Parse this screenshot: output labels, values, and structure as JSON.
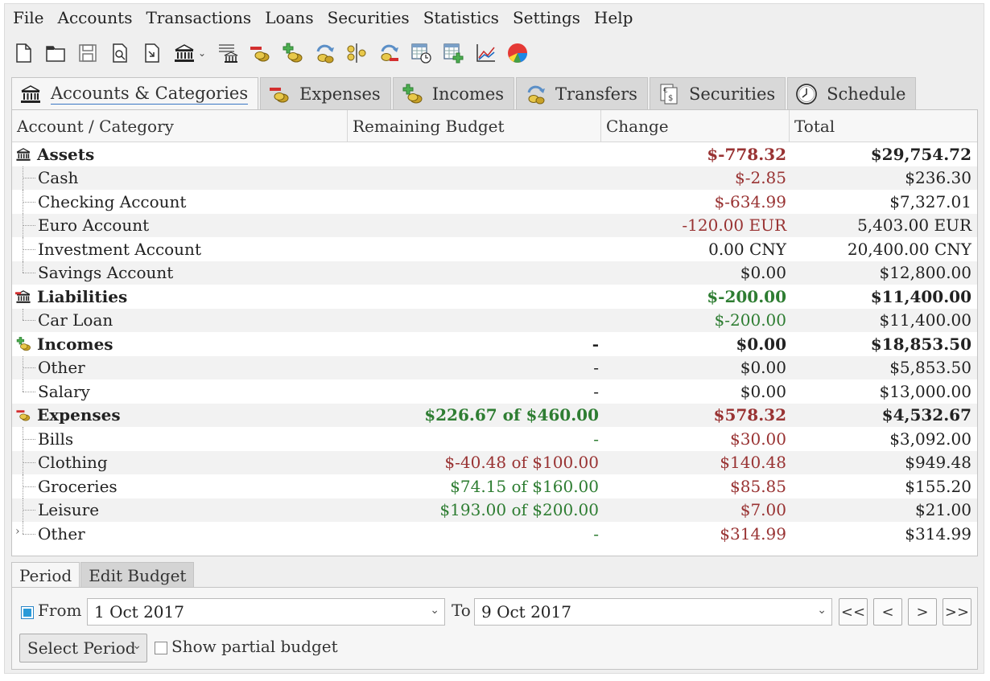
{
  "menu": [
    "File",
    "Accounts",
    "Transactions",
    "Loans",
    "Securities",
    "Statistics",
    "Settings",
    "Help"
  ],
  "toolbar": {
    "icons": [
      "new-file-icon",
      "open-folder-icon",
      "save-icon",
      "print-preview-icon",
      "export-icon",
      "bank-account-icon",
      "dropdown-arrow",
      "new-account-icon",
      "new-expense-icon",
      "new-income-icon",
      "new-transfer-icon",
      "split-transaction-icon",
      "repeat-transfer-icon",
      "schedule-icon",
      "add-schedule-icon",
      "line-chart-icon",
      "pie-chart-icon"
    ]
  },
  "tabs": [
    {
      "label": "Accounts & Categories",
      "icon": "bank-icon",
      "active": true
    },
    {
      "label": "Expenses",
      "icon": "expense-icon",
      "active": false
    },
    {
      "label": "Incomes",
      "icon": "income-icon",
      "active": false
    },
    {
      "label": "Transfers",
      "icon": "transfer-icon",
      "active": false
    },
    {
      "label": "Securities",
      "icon": "securities-icon",
      "active": false
    },
    {
      "label": "Schedule",
      "icon": "clock-icon",
      "active": false
    }
  ],
  "columns": [
    "Account / Category",
    "Remaining Budget",
    "Change",
    "Total"
  ],
  "rows": [
    {
      "name": "Assets",
      "level": 0,
      "icon": "bank",
      "budget": "",
      "change": "$-778.32",
      "change_color": "red",
      "total": "$29,754.72"
    },
    {
      "name": "Cash",
      "level": 1,
      "budget": "",
      "change": "$-2.85",
      "change_color": "red",
      "total": "$236.30"
    },
    {
      "name": "Checking Account",
      "level": 1,
      "budget": "",
      "change": "$-634.99",
      "change_color": "red",
      "total": "$7,327.01"
    },
    {
      "name": "Euro Account",
      "level": 1,
      "budget": "",
      "change": "-120.00 EUR",
      "change_color": "red",
      "total": "5,403.00 EUR"
    },
    {
      "name": "Investment Account",
      "level": 1,
      "budget": "",
      "change": "0.00 CNY",
      "change_color": "black",
      "total": "20,400.00 CNY"
    },
    {
      "name": "Savings Account",
      "level": 1,
      "budget": "",
      "change": "$0.00",
      "change_color": "black",
      "total": "$12,800.00",
      "last": true
    },
    {
      "name": "Liabilities",
      "level": 0,
      "icon": "bank-red",
      "budget": "",
      "change": "$-200.00",
      "change_color": "green",
      "total": "$11,400.00"
    },
    {
      "name": "Car Loan",
      "level": 1,
      "budget": "",
      "change": "$-200.00",
      "change_color": "green",
      "total": "$11,400.00",
      "last": true
    },
    {
      "name": "Incomes",
      "level": 0,
      "icon": "income",
      "budget": "-",
      "budget_color": "black",
      "change": "$0.00",
      "change_color": "black",
      "total": "$18,853.50"
    },
    {
      "name": "Other",
      "level": 1,
      "budget": "-",
      "budget_color": "black",
      "change": "$0.00",
      "change_color": "black",
      "total": "$5,853.50"
    },
    {
      "name": "Salary",
      "level": 1,
      "budget": "-",
      "budget_color": "black",
      "change": "$0.00",
      "change_color": "black",
      "total": "$13,000.00",
      "last": true
    },
    {
      "name": "Expenses",
      "level": 0,
      "icon": "expense",
      "budget": "$226.67 of $460.00",
      "budget_color": "green",
      "change": "$578.32",
      "change_color": "red",
      "total": "$4,532.67"
    },
    {
      "name": "Bills",
      "level": 1,
      "budget": "-",
      "budget_color": "green",
      "change": "$30.00",
      "change_color": "red",
      "total": "$3,092.00"
    },
    {
      "name": "Clothing",
      "level": 1,
      "budget": "$-40.48 of $100.00",
      "budget_color": "red",
      "change": "$140.48",
      "change_color": "red",
      "total": "$949.48"
    },
    {
      "name": "Groceries",
      "level": 1,
      "budget": "$74.15 of $160.00",
      "budget_color": "green",
      "change": "$85.85",
      "change_color": "red",
      "total": "$155.20"
    },
    {
      "name": "Leisure",
      "level": 1,
      "budget": "$193.00 of $200.00",
      "budget_color": "green",
      "change": "$7.00",
      "change_color": "red",
      "total": "$21.00"
    },
    {
      "name": "Other",
      "level": 1,
      "budget": "-",
      "budget_color": "green",
      "change": "$314.99",
      "change_color": "red",
      "total": "$314.99",
      "last": true,
      "expandable": true
    }
  ],
  "bottom_tabs": [
    "Period",
    "Edit Budget"
  ],
  "period": {
    "from_label": "From",
    "from_checked": true,
    "from_value": "1 Oct 2017",
    "to_label": "To",
    "to_value": "9 Oct 2017",
    "nav": [
      "<<",
      "<",
      ">",
      ">>"
    ],
    "select_period_label": "Select Period",
    "partial_budget_label": "Show partial budget",
    "partial_budget_checked": false
  },
  "colors": {
    "red": "#993333",
    "green": "#2e7d32",
    "accent": "#3a76c4"
  }
}
